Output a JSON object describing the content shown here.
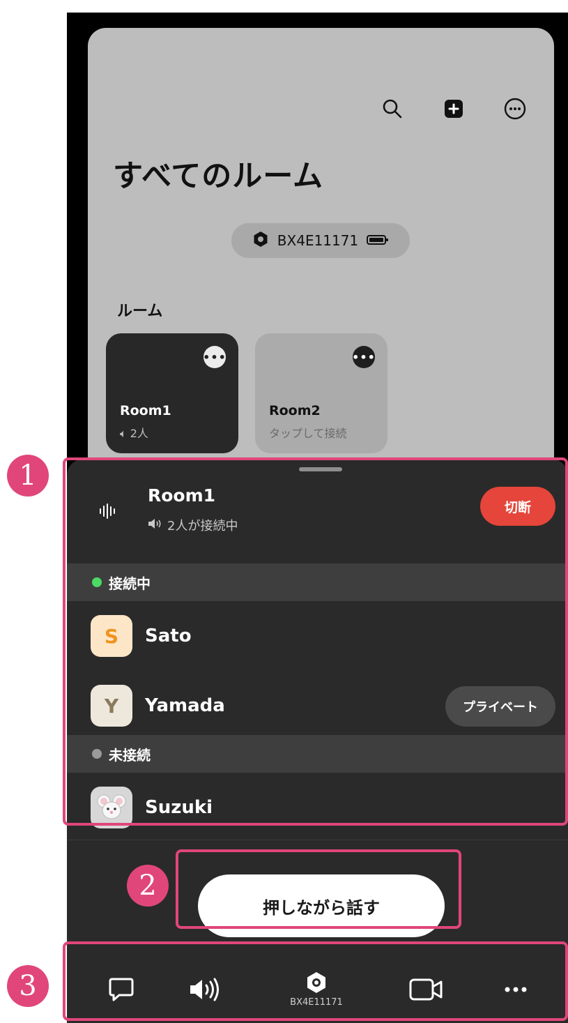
{
  "header": {
    "title": "すべてのルーム",
    "actions": [
      {
        "icon": "search-icon"
      },
      {
        "icon": "add-square-icon"
      },
      {
        "icon": "more-circle-icon"
      }
    ]
  },
  "device": {
    "id": "BX4E11171",
    "icon": "device-icon",
    "battery_icon": "battery-icon"
  },
  "rooms_section": {
    "label": "ルーム",
    "rooms": [
      {
        "name": "Room1",
        "status": "2人",
        "active": true
      },
      {
        "name": "Room2",
        "status": "タップして接続",
        "active": false
      }
    ]
  },
  "sheet": {
    "room_name": "Room1",
    "room_status": "2人が接続中",
    "disconnect_label": "切断",
    "connected_group": {
      "label": "接続中",
      "color": "#4cd964"
    },
    "disconnected_group": {
      "label": "未接続",
      "color": "#9a9a9a"
    },
    "members_connected": [
      {
        "initial": "S",
        "name": "Sato",
        "avatar_bg": "#fde6c8",
        "avatar_fg": "#f0931e"
      },
      {
        "initial": "Y",
        "name": "Yamada",
        "avatar_bg": "#eee8dc",
        "avatar_fg": "#8b7a5e",
        "badge": "プライベート"
      }
    ],
    "members_disconnected": [
      {
        "name": "Suzuki",
        "avatar_icon": "mouse-memoji-icon"
      }
    ],
    "push_to_talk_label": "押しながら話す"
  },
  "toolbar": {
    "items": [
      {
        "icon": "chat-icon"
      },
      {
        "icon": "speaker-icon"
      },
      {
        "icon": "device-icon",
        "label": "BX4E11171"
      },
      {
        "icon": "video-camera-icon"
      },
      {
        "icon": "more-horizontal-icon"
      }
    ]
  },
  "annotations": {
    "accent_color": "#e0467a",
    "badges": [
      "1",
      "2",
      "3"
    ]
  }
}
